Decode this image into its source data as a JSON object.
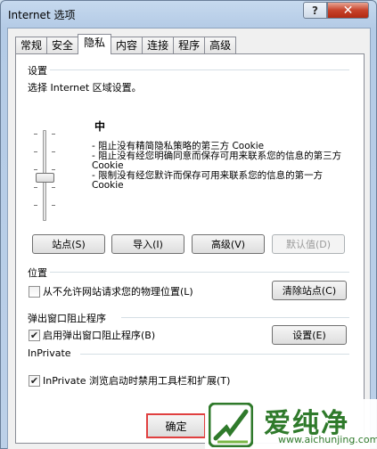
{
  "window": {
    "title": "Internet 选项",
    "help_label": "?",
    "close_label": "✕"
  },
  "tabs": [
    {
      "label": "常规",
      "active": false
    },
    {
      "label": "安全",
      "active": false
    },
    {
      "label": "隐私",
      "active": true
    },
    {
      "label": "内容",
      "active": false
    },
    {
      "label": "连接",
      "active": false
    },
    {
      "label": "程序",
      "active": false
    },
    {
      "label": "高级",
      "active": false
    }
  ],
  "settings": {
    "group_label": "设置",
    "zone_text": "选择 Internet 区域设置。",
    "level": "中",
    "slider_level": "中",
    "descriptions": [
      "- 阻止没有精简隐私策略的第三方 Cookie",
      "- 阻止没有经您明确同意而保存可用来联系您的信息的第三方 Cookie",
      "- 限制没有经您默许而保存可用来联系您的信息的第一方 Cookie"
    ],
    "buttons": {
      "sites": "站点(S)",
      "import": "导入(I)",
      "advanced": "高级(V)",
      "default": "默认值(D)"
    }
  },
  "location": {
    "group_label": "位置",
    "checkbox_label": "从不允许网站请求您的物理位置(L)",
    "checked": false,
    "clear_button": "清除站点(C)"
  },
  "popup": {
    "group_label": "弹出窗口阻止程序",
    "checkbox_label": "启用弹出窗口阻止程序(B)",
    "checked": true,
    "settings_button": "设置(E)"
  },
  "inprivate": {
    "group_label": "InPrivate",
    "checkbox_label": "InPrivate 浏览启动时禁用工具栏和扩展(T)",
    "checked": true
  },
  "footer": {
    "ok_label": "确定"
  },
  "watermark": {
    "title": "爱纯净",
    "url": "www.aichunjing.com"
  }
}
